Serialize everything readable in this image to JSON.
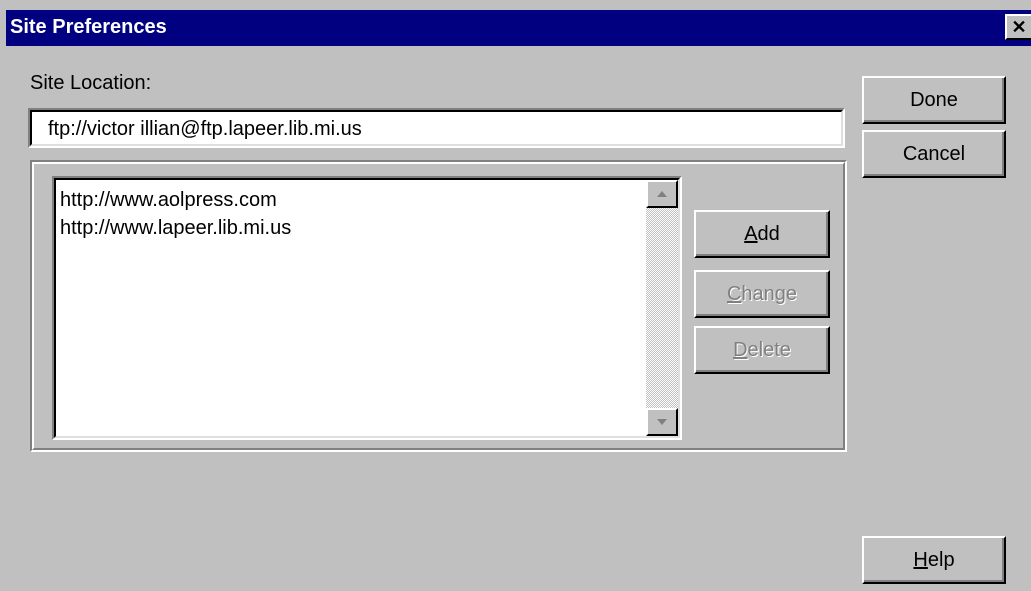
{
  "window": {
    "title": "Site Preferences",
    "close_label": "✕"
  },
  "site_location": {
    "label": "Site Location:",
    "value": "ftp://victor illian@ftp.lapeer.lib.mi.us"
  },
  "site_list": {
    "items": [
      "http://www.aolpress.com",
      "http://www.lapeer.lib.mi.us"
    ]
  },
  "buttons": {
    "done": "Done",
    "cancel": "Cancel",
    "add_mnemonic": "A",
    "add_rest": "dd",
    "change_mnemonic": "C",
    "change_rest": "hange",
    "delete_mnemonic": "D",
    "delete_rest": "elete",
    "help_mnemonic": "H",
    "help_rest": "elp"
  },
  "icons": {
    "scroll_up": "arrow-up-icon",
    "scroll_down": "arrow-down-icon",
    "close": "close-icon"
  }
}
